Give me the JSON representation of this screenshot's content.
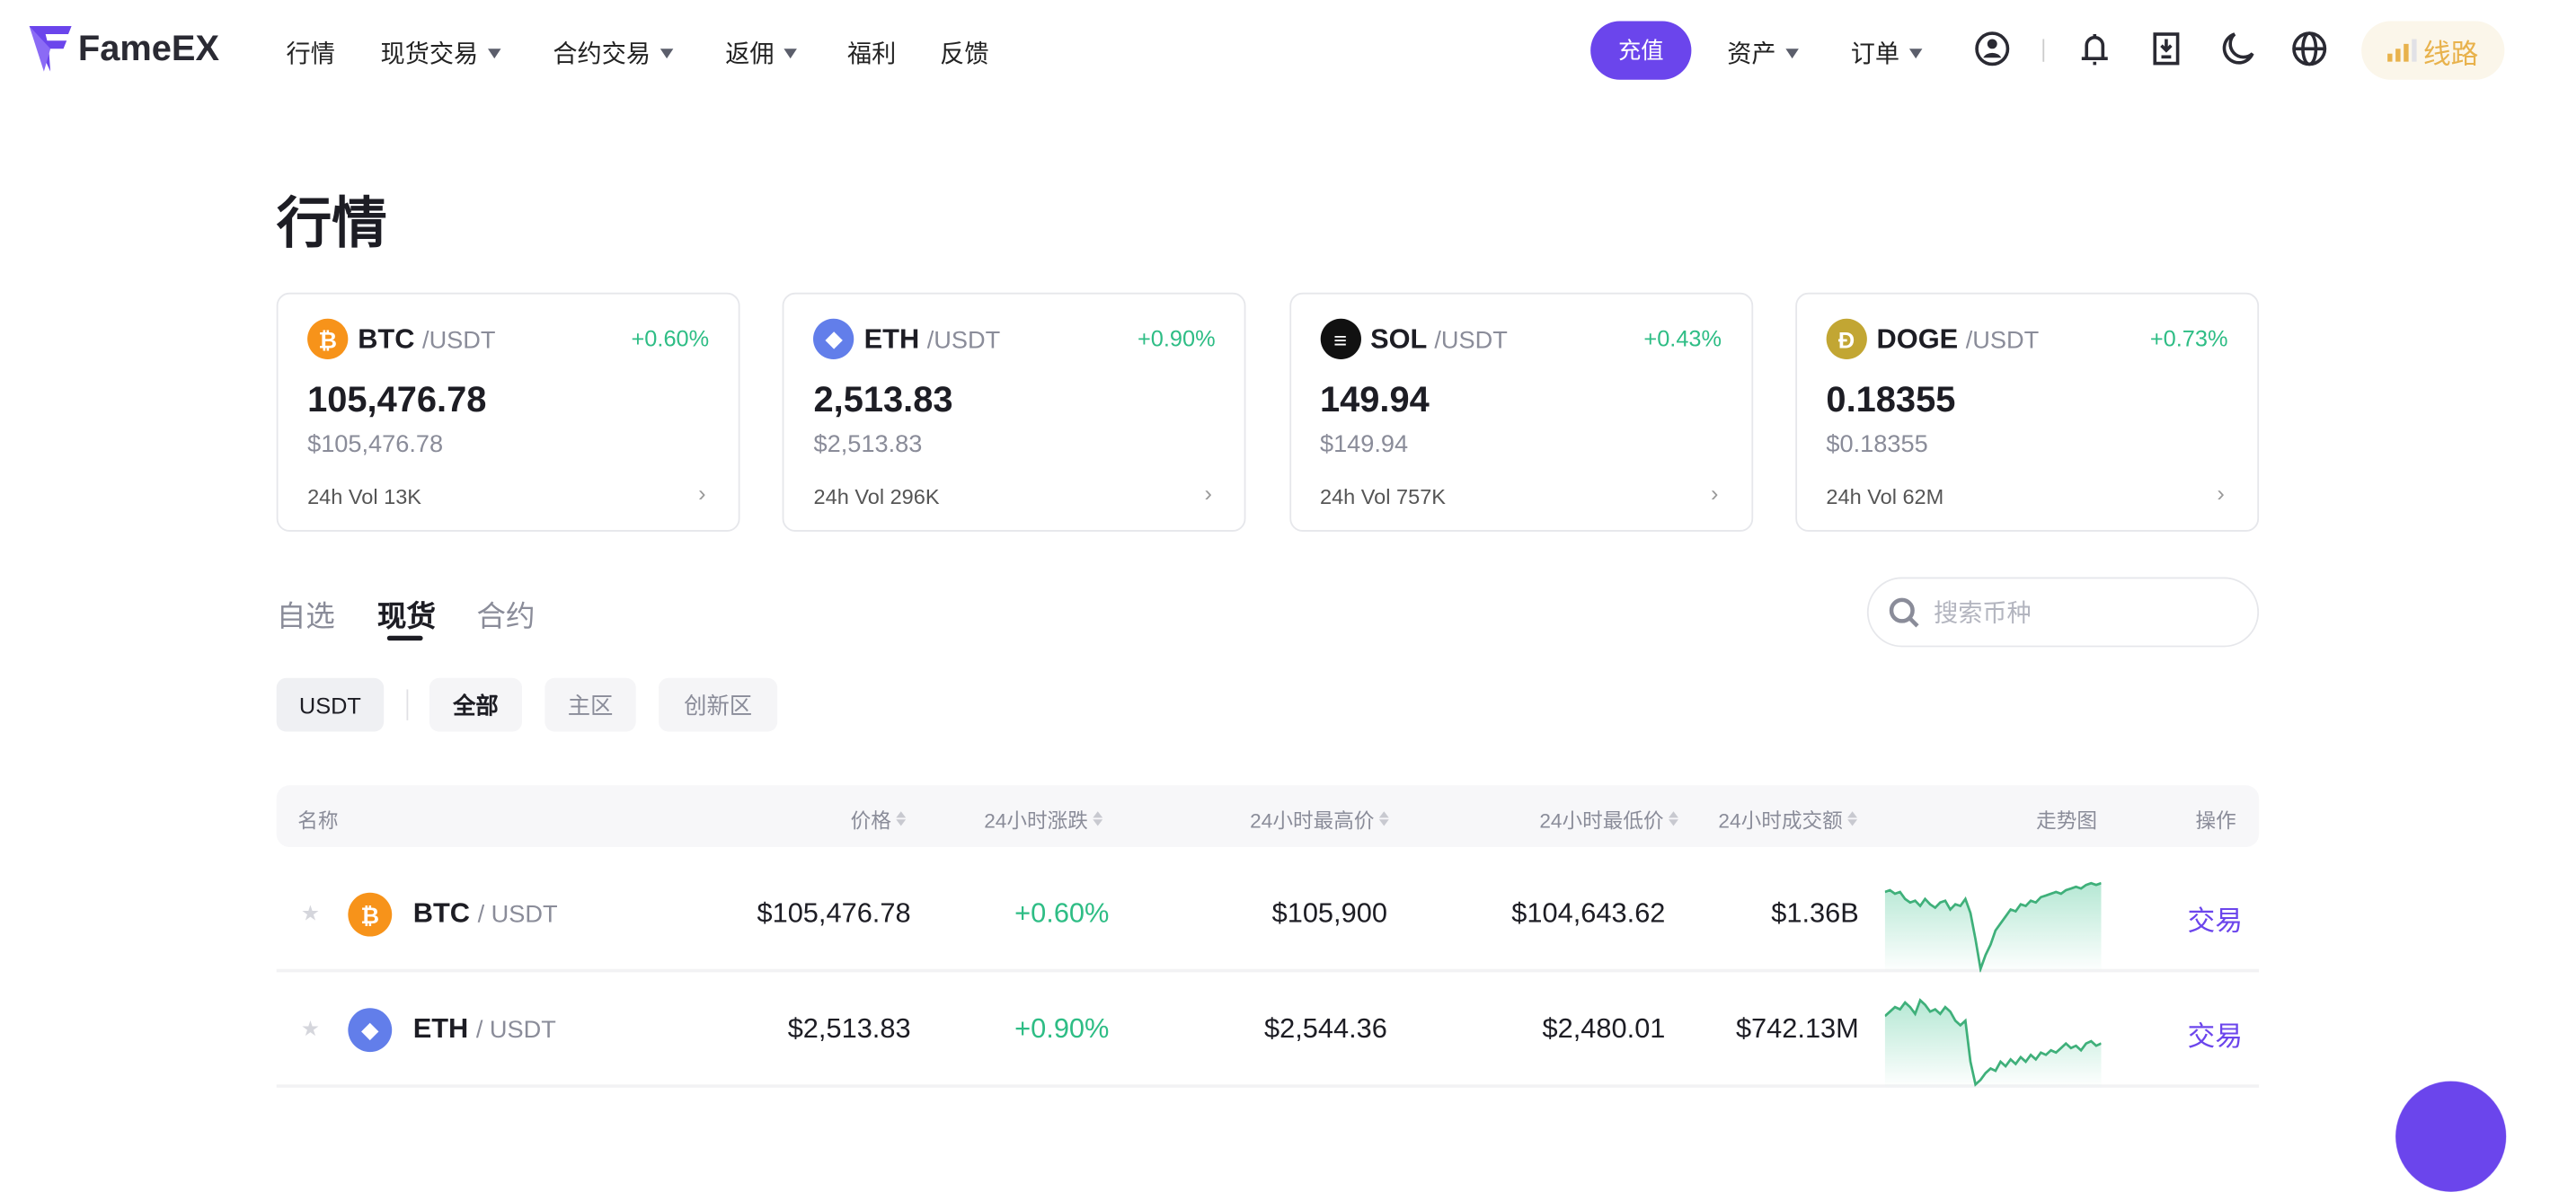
{
  "header": {
    "brand": "FameEX",
    "nav": [
      {
        "label": "行情",
        "dropdown": false
      },
      {
        "label": "现货交易",
        "dropdown": true
      },
      {
        "label": "合约交易",
        "dropdown": true
      },
      {
        "label": "返佣",
        "dropdown": true
      },
      {
        "label": "福利",
        "dropdown": false
      },
      {
        "label": "反馈",
        "dropdown": false
      }
    ],
    "deposit": "充值",
    "assets": "资产",
    "orders": "订单",
    "route": "线路",
    "icons": [
      "user-icon",
      "bell-icon",
      "download-app-icon",
      "moon-icon",
      "globe-icon",
      "signal-icon"
    ],
    "accent": "#6b45ec"
  },
  "page": {
    "title": "行情"
  },
  "cards": [
    {
      "symbol": "BTC",
      "quote": "/USDT",
      "change": "+0.60%",
      "price": "105,476.78",
      "usd": "$105,476.78",
      "vol": "24h Vol 13K",
      "color": "#f7931a",
      "glyph": "₿"
    },
    {
      "symbol": "ETH",
      "quote": "/USDT",
      "change": "+0.90%",
      "price": "2,513.83",
      "usd": "$2,513.83",
      "vol": "24h Vol 296K",
      "color": "#627eea",
      "glyph": "◆"
    },
    {
      "symbol": "SOL",
      "quote": "/USDT",
      "change": "+0.43%",
      "price": "149.94",
      "usd": "$149.94",
      "vol": "24h Vol 757K",
      "color": "#111111",
      "glyph": "≡"
    },
    {
      "symbol": "DOGE",
      "quote": "/USDT",
      "change": "+0.73%",
      "price": "0.18355",
      "usd": "$0.18355",
      "vol": "24h Vol 62M",
      "color": "#c2a633",
      "glyph": "Ð"
    }
  ],
  "tabs": [
    {
      "label": "自选"
    },
    {
      "label": "现货",
      "active": true
    },
    {
      "label": "合约"
    }
  ],
  "search": {
    "placeholder": "搜索币种"
  },
  "filters": [
    "USDT",
    "全部",
    "主区",
    "创新区"
  ],
  "table": {
    "headers": {
      "name": "名称",
      "price": "价格",
      "change": "24小时涨跌",
      "high": "24小时最高价",
      "low": "24小时最低价",
      "turnover": "24小时成交额",
      "trend": "走势图",
      "action": "操作"
    },
    "rows": [
      {
        "base": "BTC",
        "quote": "/ USDT",
        "price": "$105,476.78",
        "change": "+0.60%",
        "high": "$105,900",
        "low": "$104,643.62",
        "turnover": "$1.36B",
        "action": "交易",
        "color": "#f7931a",
        "glyph": "₿",
        "sparkline": [
          8,
          7,
          9,
          8,
          12,
          14,
          13,
          16,
          12,
          15,
          17,
          14,
          13,
          18,
          15,
          16,
          12,
          20,
          35,
          52,
          44,
          38,
          30,
          26,
          22,
          18,
          19,
          15,
          16,
          13,
          14,
          11,
          10,
          9,
          8,
          9,
          7,
          6,
          5,
          6,
          4,
          3,
          4,
          3
        ]
      },
      {
        "base": "ETH",
        "quote": "/ USDT",
        "price": "$2,513.83",
        "change": "+0.90%",
        "high": "$2,544.36",
        "low": "$2,480.01",
        "turnover": "$742.13M",
        "action": "交易",
        "color": "#627eea",
        "glyph": "◆",
        "sparkline": [
          10,
          8,
          6,
          7,
          4,
          6,
          9,
          3,
          5,
          8,
          7,
          9,
          6,
          8,
          12,
          14,
          12,
          30,
          40,
          38,
          35,
          33,
          34,
          30,
          32,
          29,
          31,
          28,
          30,
          27,
          29,
          26,
          27,
          25,
          26,
          24,
          22,
          24,
          23,
          25,
          22,
          21,
          23,
          22
        ]
      }
    ]
  },
  "colors": {
    "up": "#2ebd85",
    "accent": "#6b45ec"
  }
}
